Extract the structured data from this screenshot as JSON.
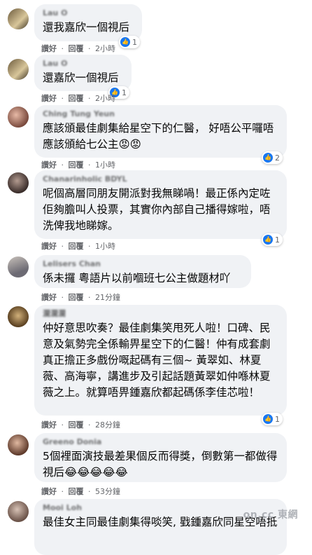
{
  "actions": {
    "like": "讚好",
    "reply": "回覆",
    "sep": "·"
  },
  "comments": [
    {
      "name": "Lau O",
      "text": "還我嘉欣一個視后",
      "time": "2小時",
      "reactions": "1"
    },
    {
      "name": "Lau O",
      "text": "還嘉欣一個視后",
      "time": "2小時",
      "reactions": "1"
    },
    {
      "name": "Ching Tung Yeun",
      "text": "應該頒最佳劇集給星空下的仁醫， 好唔公平囉唔應該頒給七公主😡😡",
      "time": "1小時",
      "reactions": "2"
    },
    {
      "name": "Chanarinholic BDYL",
      "text": "呢個高層同朋友開派對我無睇喎！最正係內定咗佢夠膽叫人投票，其實你內部自己播得嫁啦，唔洗俾我地睇嫁。",
      "time": "1小時",
      "reactions": "1"
    },
    {
      "name": "Lelisers Chan",
      "text": "係未攞 粵語片以前嗰班七公主做題材吖",
      "time": "21分鐘",
      "reactions": ""
    },
    {
      "name": "瀾瀾瀾",
      "text": "仲好意思吹奏？最佳劇集笑甩死人啦！口碑、民意及氣勢完全係輸畀星空下的仁醫！仲有成套劇真正擔正多戲份嘅起碼有三個~ 黃翠如、林夏薇、高海寧，講進步及引起話題黃翠如仲喺林夏薇之上。就算唔畀鍾嘉欣都起碼係李佳芯啦！",
      "time": "28分鐘",
      "reactions": "1"
    },
    {
      "name": "Greeno Donia",
      "text": "5個裡面演技最差果個反而得獎，倒數第一都做得視后😂😂😂😂😂",
      "time": "53分鐘",
      "reactions": ""
    },
    {
      "name": "Mooi Loh",
      "text": "最佳女主同最佳劇集得啖笑, 戥鍾嘉欣同星空唔抵",
      "time": "",
      "reactions": ""
    }
  ],
  "watermark": "on.cc 東網",
  "colors": {
    "bubble": "#f0f2f5",
    "like_blue": "#1877f2",
    "meta_gray": "#65676b"
  }
}
